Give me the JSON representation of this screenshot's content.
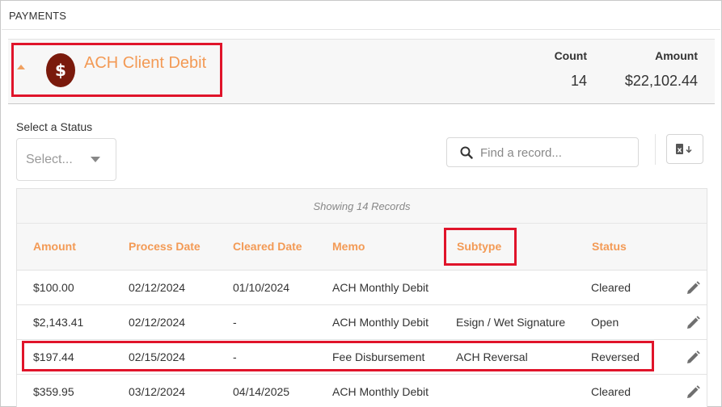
{
  "panel": {
    "title": "PAYMENTS"
  },
  "category": {
    "name": "ACH Client Debit",
    "icon": "dollar-icon",
    "icon_color": "#7a1a0c",
    "accent": "#f39a55"
  },
  "summary": {
    "count_label": "Count",
    "count_value": "14",
    "amount_label": "Amount",
    "amount_value": "$22,102.44"
  },
  "filters": {
    "status_label": "Select a Status",
    "status_placeholder": "Select...",
    "search_placeholder": "Find a record...",
    "search_value": ""
  },
  "table": {
    "showing_text": "Showing 14 Records",
    "columns": [
      "Amount",
      "Process Date",
      "Cleared Date",
      "Memo",
      "Subtype",
      "Status"
    ],
    "rows": [
      {
        "amount": "$100.00",
        "process_date": "02/12/2024",
        "cleared_date": "01/10/2024",
        "memo": "ACH Monthly Debit",
        "subtype": "",
        "status": "Cleared"
      },
      {
        "amount": "$2,143.41",
        "process_date": "02/12/2024",
        "cleared_date": "-",
        "memo": "ACH Monthly Debit",
        "subtype": "Esign / Wet Signature",
        "status": "Open"
      },
      {
        "amount": "$197.44",
        "process_date": "02/15/2024",
        "cleared_date": "-",
        "memo": "Fee Disbursement",
        "subtype": "ACH Reversal",
        "status": "Reversed"
      },
      {
        "amount": "$359.95",
        "process_date": "03/12/2024",
        "cleared_date": "04/14/2025",
        "memo": "ACH Monthly Debit",
        "subtype": "",
        "status": "Cleared"
      }
    ]
  },
  "highlight_color": "#e0142a"
}
